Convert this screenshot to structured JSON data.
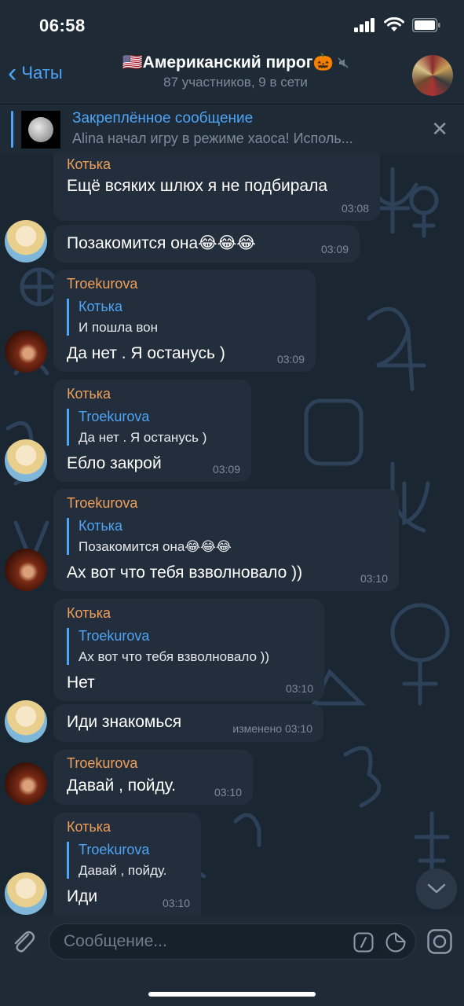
{
  "status_bar": {
    "time": "06:58"
  },
  "nav": {
    "back_label": "Чаты",
    "title": "🇺🇸Американский пирог🎃",
    "subtitle": "87 участников, 9 в сети"
  },
  "pinned": {
    "title": "Закреплённое сообщение",
    "text": "Alina начал игру в режиме хаоса! Исполь..."
  },
  "messages": [
    {
      "sender": "Котька",
      "text": "Ещё всяких шлюх я не подбирала",
      "time": "03:08"
    },
    {
      "sender": "",
      "text": "Позакомится она😂😂😂",
      "time": "03:09"
    },
    {
      "sender": "Troekurova",
      "reply_name": "Котька",
      "reply_text": "И пошла вон",
      "text": "Да нет .  Я останусь )",
      "time": "03:09"
    },
    {
      "sender": "Котька",
      "reply_name": "Troekurova",
      "reply_text": "Да нет .  Я останусь )",
      "text": "Ебло закрой",
      "time": "03:09"
    },
    {
      "sender": "Troekurova",
      "reply_name": "Котька",
      "reply_text": "Позакомится она😂😂😂",
      "text": "Ах вот что тебя взволновало ))",
      "time": "03:10"
    },
    {
      "sender": "Котька",
      "reply_name": "Troekurova",
      "reply_text": "Ах вот что тебя взволновало ))",
      "text": "Нет",
      "time": "03:10"
    },
    {
      "sender": "",
      "text": "Иди знакомься",
      "time": "изменено 03:10"
    },
    {
      "sender": "Troekurova",
      "text": "Давай , пойду.",
      "time": "03:10"
    },
    {
      "sender": "Котька",
      "reply_name": "Troekurova",
      "reply_text": "Давай , пойду.",
      "text": "Иди",
      "time": "03:10"
    }
  ],
  "input": {
    "placeholder": "Сообщение..."
  },
  "colors": {
    "accent": "#4ea4f5",
    "sender_name": "#f0a05a",
    "bubble": "#232e3c",
    "background": "#17212b"
  }
}
